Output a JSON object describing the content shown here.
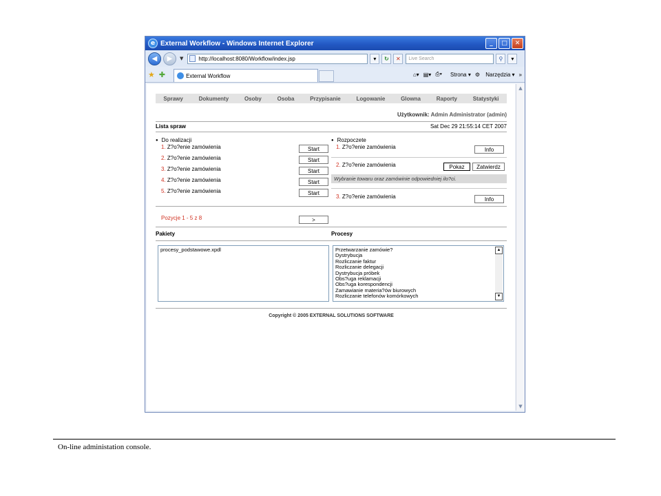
{
  "window": {
    "title": "External Workflow - Windows Internet Explorer",
    "address": "http://localhost:8080/Workflow/index.jsp",
    "search_placeholder": "Live Search",
    "tab_title": "External Workflow",
    "cmd_home": "",
    "cmd_page": "Strona",
    "cmd_tools": "Narzędzia",
    "chevron": "»"
  },
  "menu": [
    "Sprawy",
    "Dokumenty",
    "Osoby",
    "Osoba",
    "Przypisanie",
    "Logowanie",
    "Glowna",
    "Raporty",
    "Statystyki"
  ],
  "user": {
    "label": "Użytkownik:",
    "name": "Admin Administrator (admin)"
  },
  "lista": {
    "title": "Lista spraw",
    "date": "Sat Dec 29 21:55:14 CET 2007"
  },
  "do_realizacji": {
    "heading": "Do realizacji",
    "items": [
      {
        "num": "1.",
        "text": "Z?o?enie zamówienia",
        "button": "Start"
      },
      {
        "num": "2.",
        "text": "Z?o?enie zamówienia",
        "button": "Start"
      },
      {
        "num": "3.",
        "text": "Z?o?enie zamówienia",
        "button": "Start"
      },
      {
        "num": "4.",
        "text": "Z?o?enie zamówienia",
        "button": "Start"
      },
      {
        "num": "5.",
        "text": "Z?o?enie zamówienia",
        "button": "Start"
      }
    ]
  },
  "rozpoczete": {
    "heading": "Rozpoczete",
    "item1": {
      "num": "1.",
      "text": "Z?o?enie zamówienia",
      "button": "Info"
    },
    "item2": {
      "num": "2.",
      "text": "Z?o?enie zamówienia",
      "button_show": "Pokaz",
      "button_confirm": "Zatwierdz",
      "details": "Wybranie towaru oraz zamówinie odpowiedniej ilo?ci."
    },
    "item3": {
      "num": "3.",
      "text": "Z?o?enie zamówienia",
      "button": "Info"
    }
  },
  "pagination": {
    "text": "Pozycje 1 - 5 z 8",
    "next": ">"
  },
  "pakiety": {
    "title": "Pakiety",
    "items": [
      "procesy_podstawowe.xpdl"
    ]
  },
  "procesy": {
    "title": "Procesy",
    "items": [
      "Przetwarzanie zamówie?",
      "Dystrybucja",
      "Rozliczanie faktur",
      "Rozliczanie delegacji",
      "Dystrybucja próbek",
      "Obs?uga reklamacji",
      "Obs?uga korespondencji",
      "Zamawianie materia?ów biurowych",
      "Rozliczanie telefonów komórkowych"
    ]
  },
  "copyright": "Copyright © 2005 EXTERNAL SOLUTIONS SOFTWARE",
  "caption": "On-line administation console."
}
